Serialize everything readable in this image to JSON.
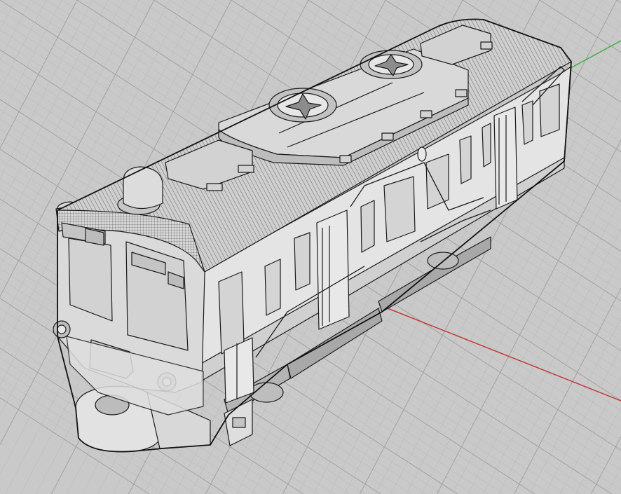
{
  "viewport": {
    "label": "",
    "background": "#c9c9c9",
    "grid_major_color": "#9e9e9e",
    "grid_minor_color": "#b6b6b6",
    "axis_x_color": "#c23b3b",
    "axis_y_color": "#3fae3f"
  },
  "model": {
    "type": "train-car",
    "body_fill": "#e4e4e4",
    "roof_fill": "#cfcfcf",
    "shadow_fill": "#a8a8a8",
    "window_fill": "#d2d2d2",
    "wire_color": "#1a1a1a",
    "fans": 2,
    "side_doors": 4,
    "front_lights": 2
  }
}
